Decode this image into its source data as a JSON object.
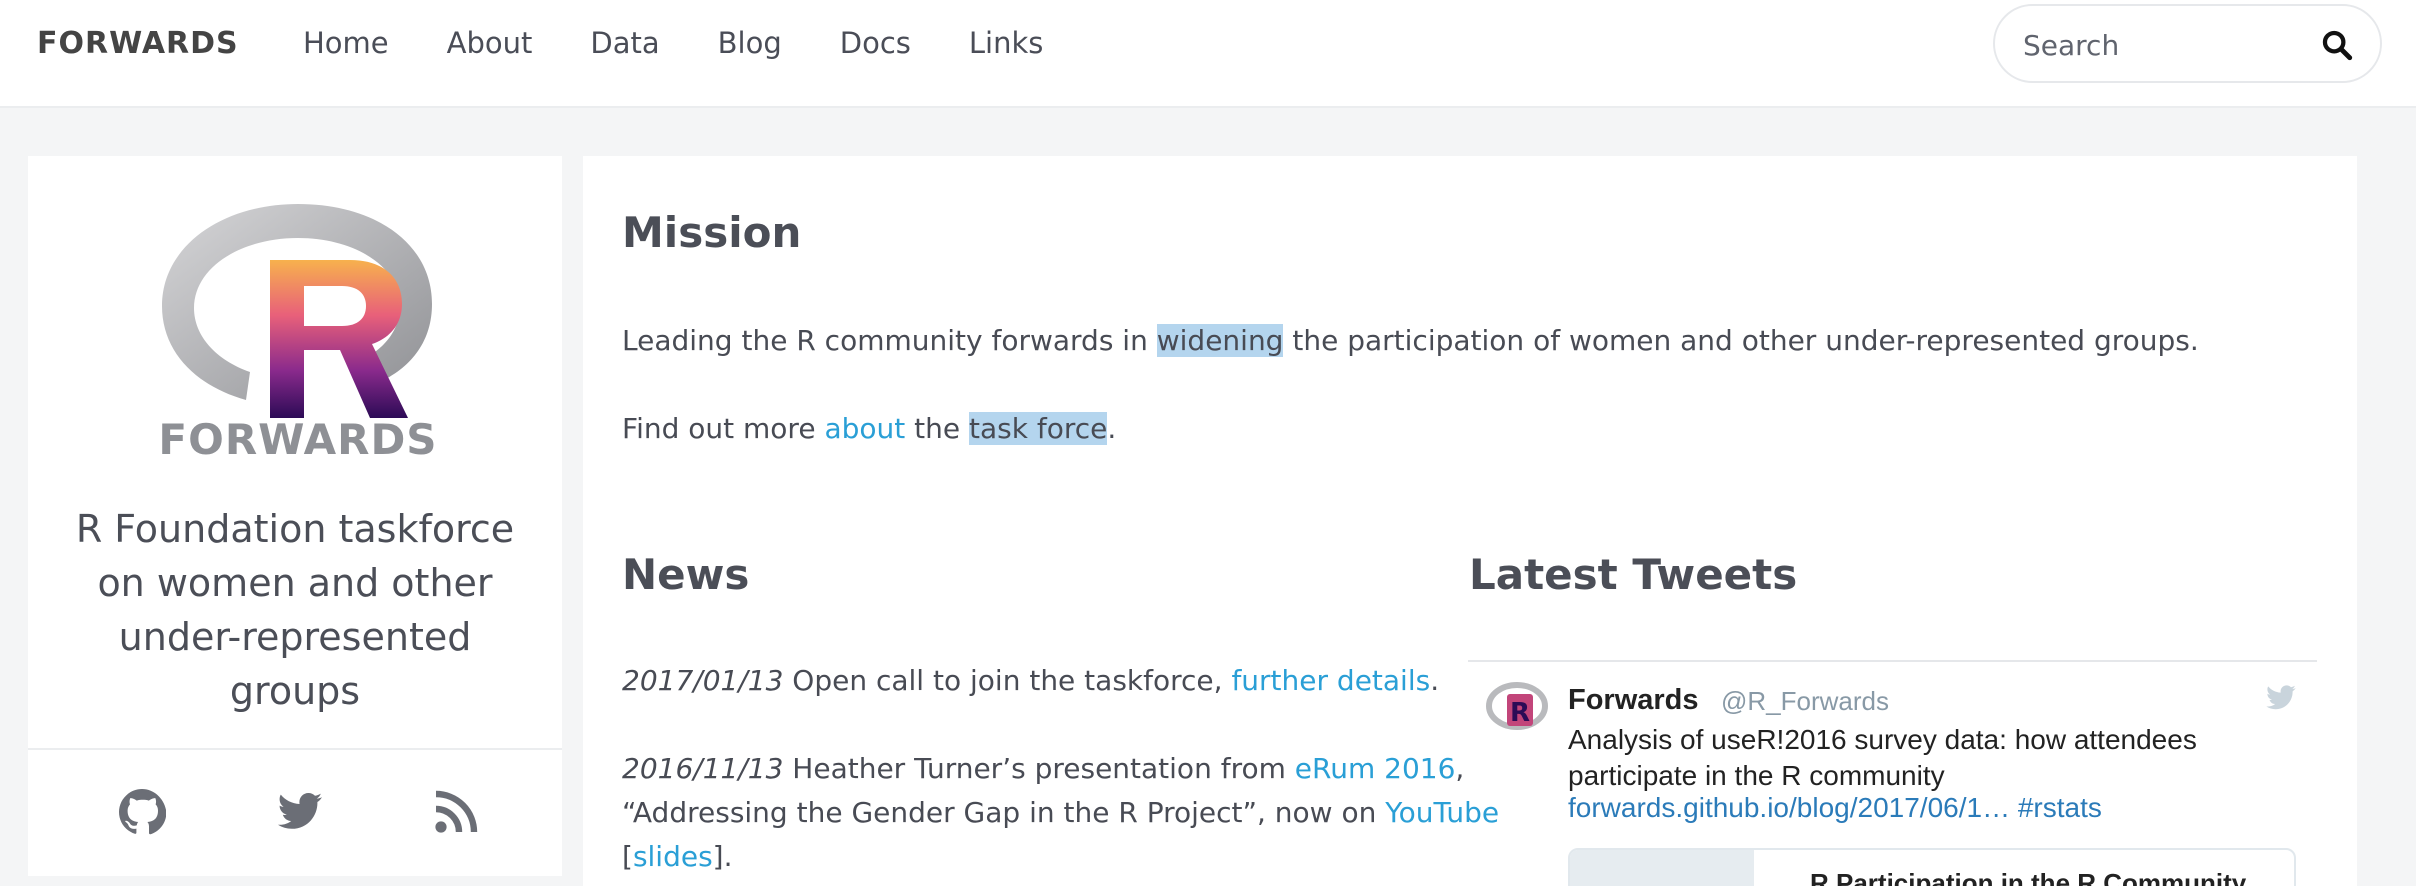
{
  "header": {
    "brand": "FORWARDS",
    "nav": [
      "Home",
      "About",
      "Data",
      "Blog",
      "Docs",
      "Links"
    ],
    "search_placeholder": "Search"
  },
  "sidebar": {
    "logo_text": "FORWARDS",
    "logo_letter": "R",
    "tagline": "R Foundation taskforce on women and other under-represented groups",
    "social_icons": [
      "github-icon",
      "twitter-icon",
      "rss-icon"
    ]
  },
  "mission": {
    "heading": "Mission",
    "line1_before": "Leading the R community forwards in ",
    "line1_highlight": "widening",
    "line1_after": " the participation of women and other under-represented groups.",
    "line2_before": "Find out more ",
    "line2_link": "about",
    "line2_mid": " the ",
    "line2_highlight": "task force",
    "line2_after": "."
  },
  "news": {
    "heading": "News",
    "items": [
      {
        "date": "2017/01/13",
        "text": " Open call to join the taskforce, ",
        "link": "further details",
        "after": "."
      },
      {
        "date": "2016/11/13",
        "text": " Heather Turner’s presentation from ",
        "link": "eRum 2016",
        "after": ",",
        "line2": "“Addressing the Gender Gap in the R Project”, now on ",
        "link2": "YouTube",
        "line3_open": "[",
        "link3": "slides",
        "line3_close": "]."
      }
    ]
  },
  "tweets": {
    "heading": "Latest Tweets",
    "name": "Forwards",
    "handle": "@R_Forwards",
    "text": "Analysis of useR!2016 survey data: how attendees participate in the R community",
    "link": "forwards.github.io/blog/2017/06/1… #rstats",
    "card_title": "R Participation in the R Community"
  },
  "colors": {
    "accent": "#2a9fd6",
    "highlight": "#b4d5ee",
    "background": "#f4f5f6"
  }
}
